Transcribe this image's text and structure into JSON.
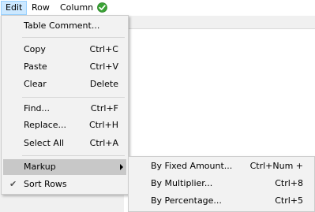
{
  "menubar": {
    "items": [
      {
        "label": "Edit"
      },
      {
        "label": "Row"
      },
      {
        "label": "Column"
      }
    ],
    "ok_icon": "green-checkmark-icon"
  },
  "edit_menu": {
    "table_comment": {
      "label": "Table Comment..."
    },
    "copy": {
      "label": "Copy",
      "shortcut": "Ctrl+C"
    },
    "paste": {
      "label": "Paste",
      "shortcut": "Ctrl+V"
    },
    "clear": {
      "label": "Clear",
      "shortcut": "Delete"
    },
    "find": {
      "label": "Find...",
      "shortcut": "Ctrl+F"
    },
    "replace": {
      "label": "Replace...",
      "shortcut": "Ctrl+H"
    },
    "select_all": {
      "label": "Select All",
      "shortcut": "Ctrl+A"
    },
    "markup": {
      "label": "Markup"
    },
    "sort_rows": {
      "label": "Sort Rows",
      "checked": true,
      "check_glyph": "✔"
    }
  },
  "markup_submenu": {
    "fixed_amount": {
      "label": "By Fixed Amount...",
      "shortcut": "Ctrl+Num +"
    },
    "multiplier": {
      "label": "By Multiplier...",
      "shortcut": "Ctrl+8"
    },
    "percentage": {
      "label": "By Percentage...",
      "shortcut": "Ctrl+5"
    }
  },
  "colors": {
    "menu_bg": "#f2f2f2",
    "highlight": "#c8c8c8",
    "active_menubar": "#cce8ff",
    "ok_green": "#3aa335"
  }
}
